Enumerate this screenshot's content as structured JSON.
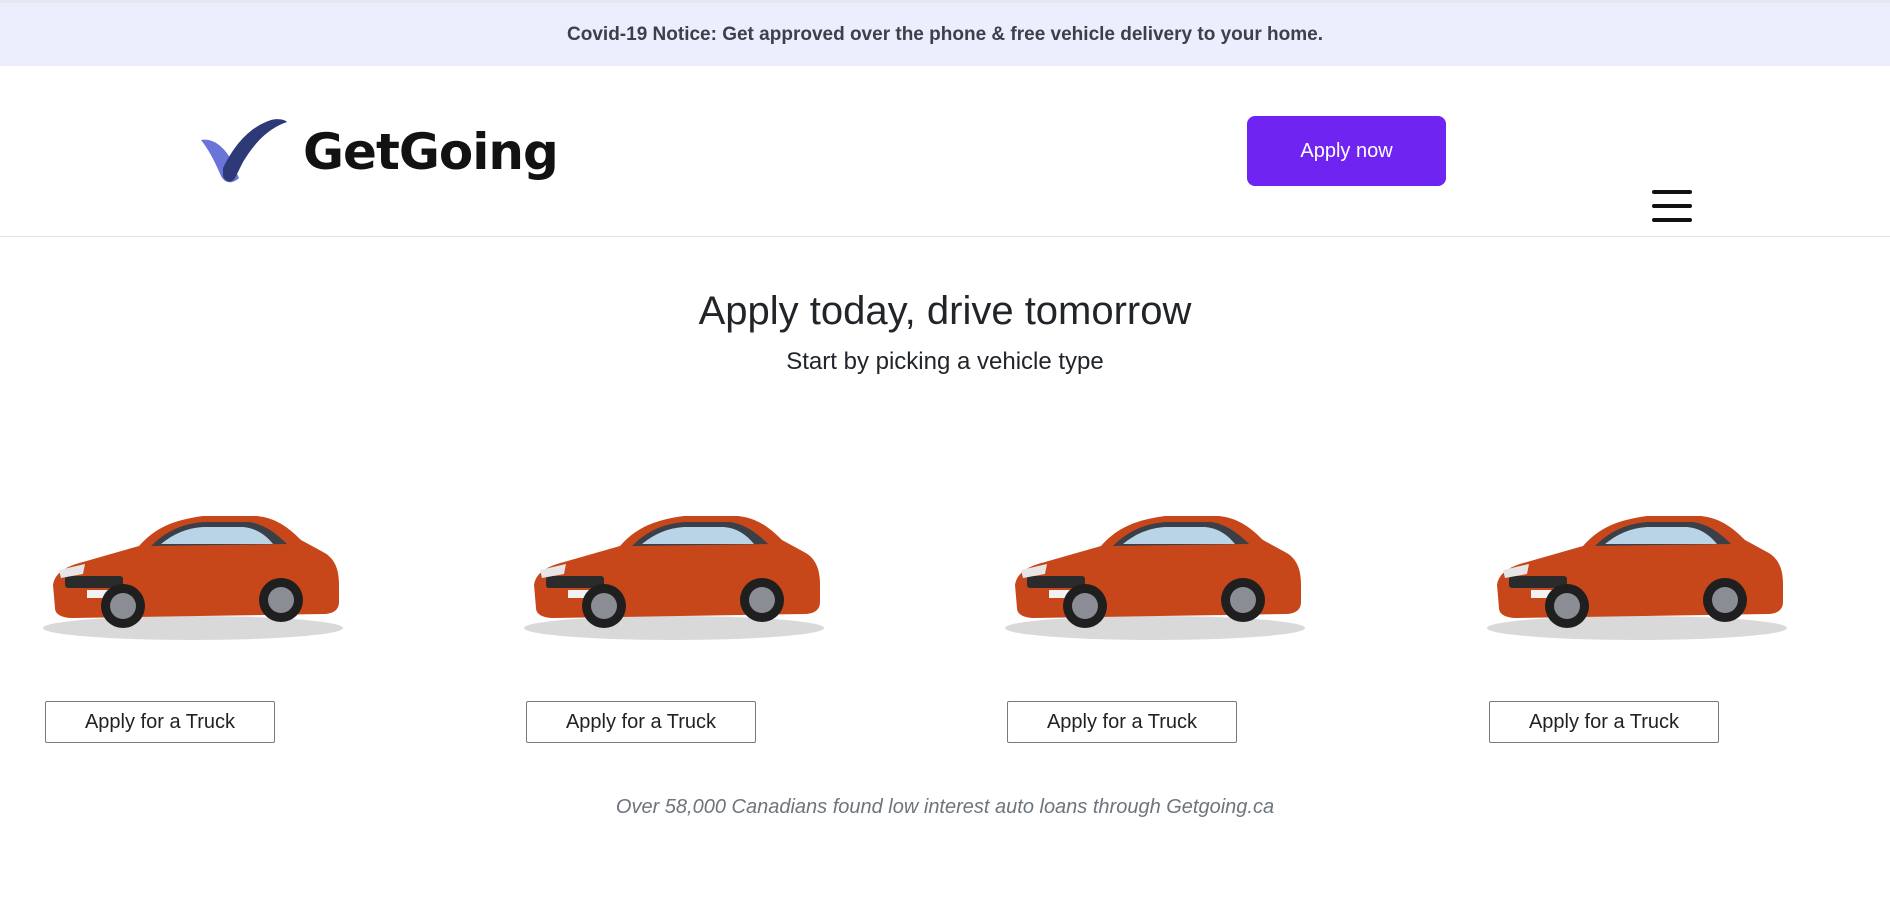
{
  "notice": {
    "text": "Covid-19 Notice: Get approved over the phone & free vehicle delivery to your home."
  },
  "header": {
    "logo_text": "GetGoing",
    "apply_button": "Apply now",
    "menu_icon": "hamburger-menu-icon"
  },
  "hero": {
    "title": "Apply today, drive tomorrow",
    "subtitle": "Start by picking a vehicle type"
  },
  "vehicles": [
    {
      "image": "orange-sedan",
      "button_label": "Apply for a Truck"
    },
    {
      "image": "orange-sedan",
      "button_label": "Apply for a Truck"
    },
    {
      "image": "orange-sedan",
      "button_label": "Apply for a Truck"
    },
    {
      "image": "orange-sedan",
      "button_label": "Apply for a Truck"
    }
  ],
  "footer": {
    "note": "Over 58,000 Canadians found low interest auto loans through Getgoing.ca"
  },
  "colors": {
    "brand_purple": "#7024f2",
    "notice_bg": "#ebeefc",
    "logo_navy": "#2e3a78",
    "logo_lavender": "#6b75d9",
    "car_orange": "#c7471b"
  }
}
